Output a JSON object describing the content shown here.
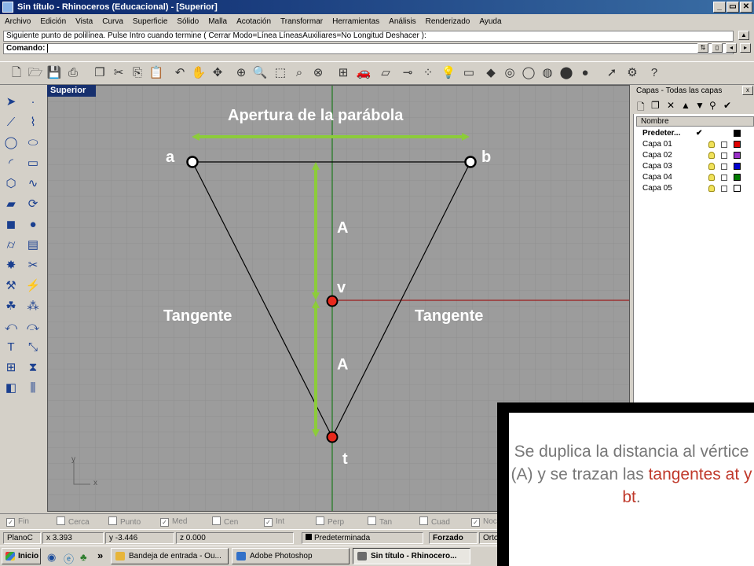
{
  "window": {
    "title": "Sin título - Rhinoceros (Educacional) - [Superior]",
    "btn_min": "_",
    "btn_restore": "▭",
    "btn_close": "✕"
  },
  "menu": [
    "Archivo",
    "Edición",
    "Vista",
    "Curva",
    "Superficie",
    "Sólido",
    "Malla",
    "Acotación",
    "Transformar",
    "Herramientas",
    "Análisis",
    "Renderizado",
    "Ayuda"
  ],
  "command": {
    "history": "Siguiente punto de polilínea. Pulse Intro cuando termine ( Cerrar  Modo=Línea  LíneasAuxiliares=No  Longitud  Deshacer ):",
    "prompt_label": "Comando:",
    "prompt_value": ""
  },
  "viewport": {
    "title": "Superior",
    "axis_y": "y",
    "axis_x": "x"
  },
  "drawing": {
    "opening_label": "Apertura de la parábola",
    "point_a": "a",
    "point_b": "b",
    "point_v": "v",
    "point_t": "t",
    "dist_upper": "A",
    "dist_lower": "A",
    "tangent_left": "Tangente",
    "tangent_right": "Tangente",
    "colors": {
      "guide_green": "#8ccc3a",
      "axis_green": "#1e7a1e",
      "axis_red": "#9c1d1d",
      "point_red": "#e8291c"
    }
  },
  "layers": {
    "title": "Capas - Todas las capas",
    "column_name": "Nombre",
    "rows": [
      {
        "name": "Predeter...",
        "check": "✔",
        "color": "#000000",
        "current": true
      },
      {
        "name": "Capa 01",
        "check": "",
        "color": "#e00000",
        "current": false
      },
      {
        "name": "Capa 02",
        "check": "",
        "color": "#9a30c8",
        "current": false
      },
      {
        "name": "Capa 03",
        "check": "",
        "color": "#0000d0",
        "current": false
      },
      {
        "name": "Capa 04",
        "check": "",
        "color": "#007a00",
        "current": false
      },
      {
        "name": "Capa 05",
        "check": "",
        "color": "#ffffff",
        "current": false
      }
    ]
  },
  "osnaps": [
    {
      "label": "Fin",
      "checked": true
    },
    {
      "label": "Cerca",
      "checked": false
    },
    {
      "label": "Punto",
      "checked": false
    },
    {
      "label": "Med",
      "checked": true
    },
    {
      "label": "Cen",
      "checked": false
    },
    {
      "label": "Int",
      "checked": true
    },
    {
      "label": "Perp",
      "checked": false
    },
    {
      "label": "Tan",
      "checked": false
    },
    {
      "label": "Cuad",
      "checked": false
    },
    {
      "label": "Noc",
      "checked": true
    }
  ],
  "status": {
    "plane": "PlanoC",
    "x": "x 3.393",
    "y": "y -3.446",
    "z": "z 0.000",
    "layer": "Predeterminada",
    "snap": "Forzado",
    "ortho": "Orto"
  },
  "taskbar": {
    "start": "Inicio",
    "more": "»",
    "tasks": [
      {
        "label": "Bandeja de entrada - Ou...",
        "color": "#e7b53a"
      },
      {
        "label": "Adobe Photoshop",
        "color": "#3170c8"
      },
      {
        "label": "Sin título - Rhinocero...",
        "color": "#6b6b6b"
      }
    ]
  },
  "note": {
    "part1": "Se duplica la distancia al vértice (A) y se trazan las ",
    "highlight": "tangentes at y bt",
    "part2": "."
  }
}
